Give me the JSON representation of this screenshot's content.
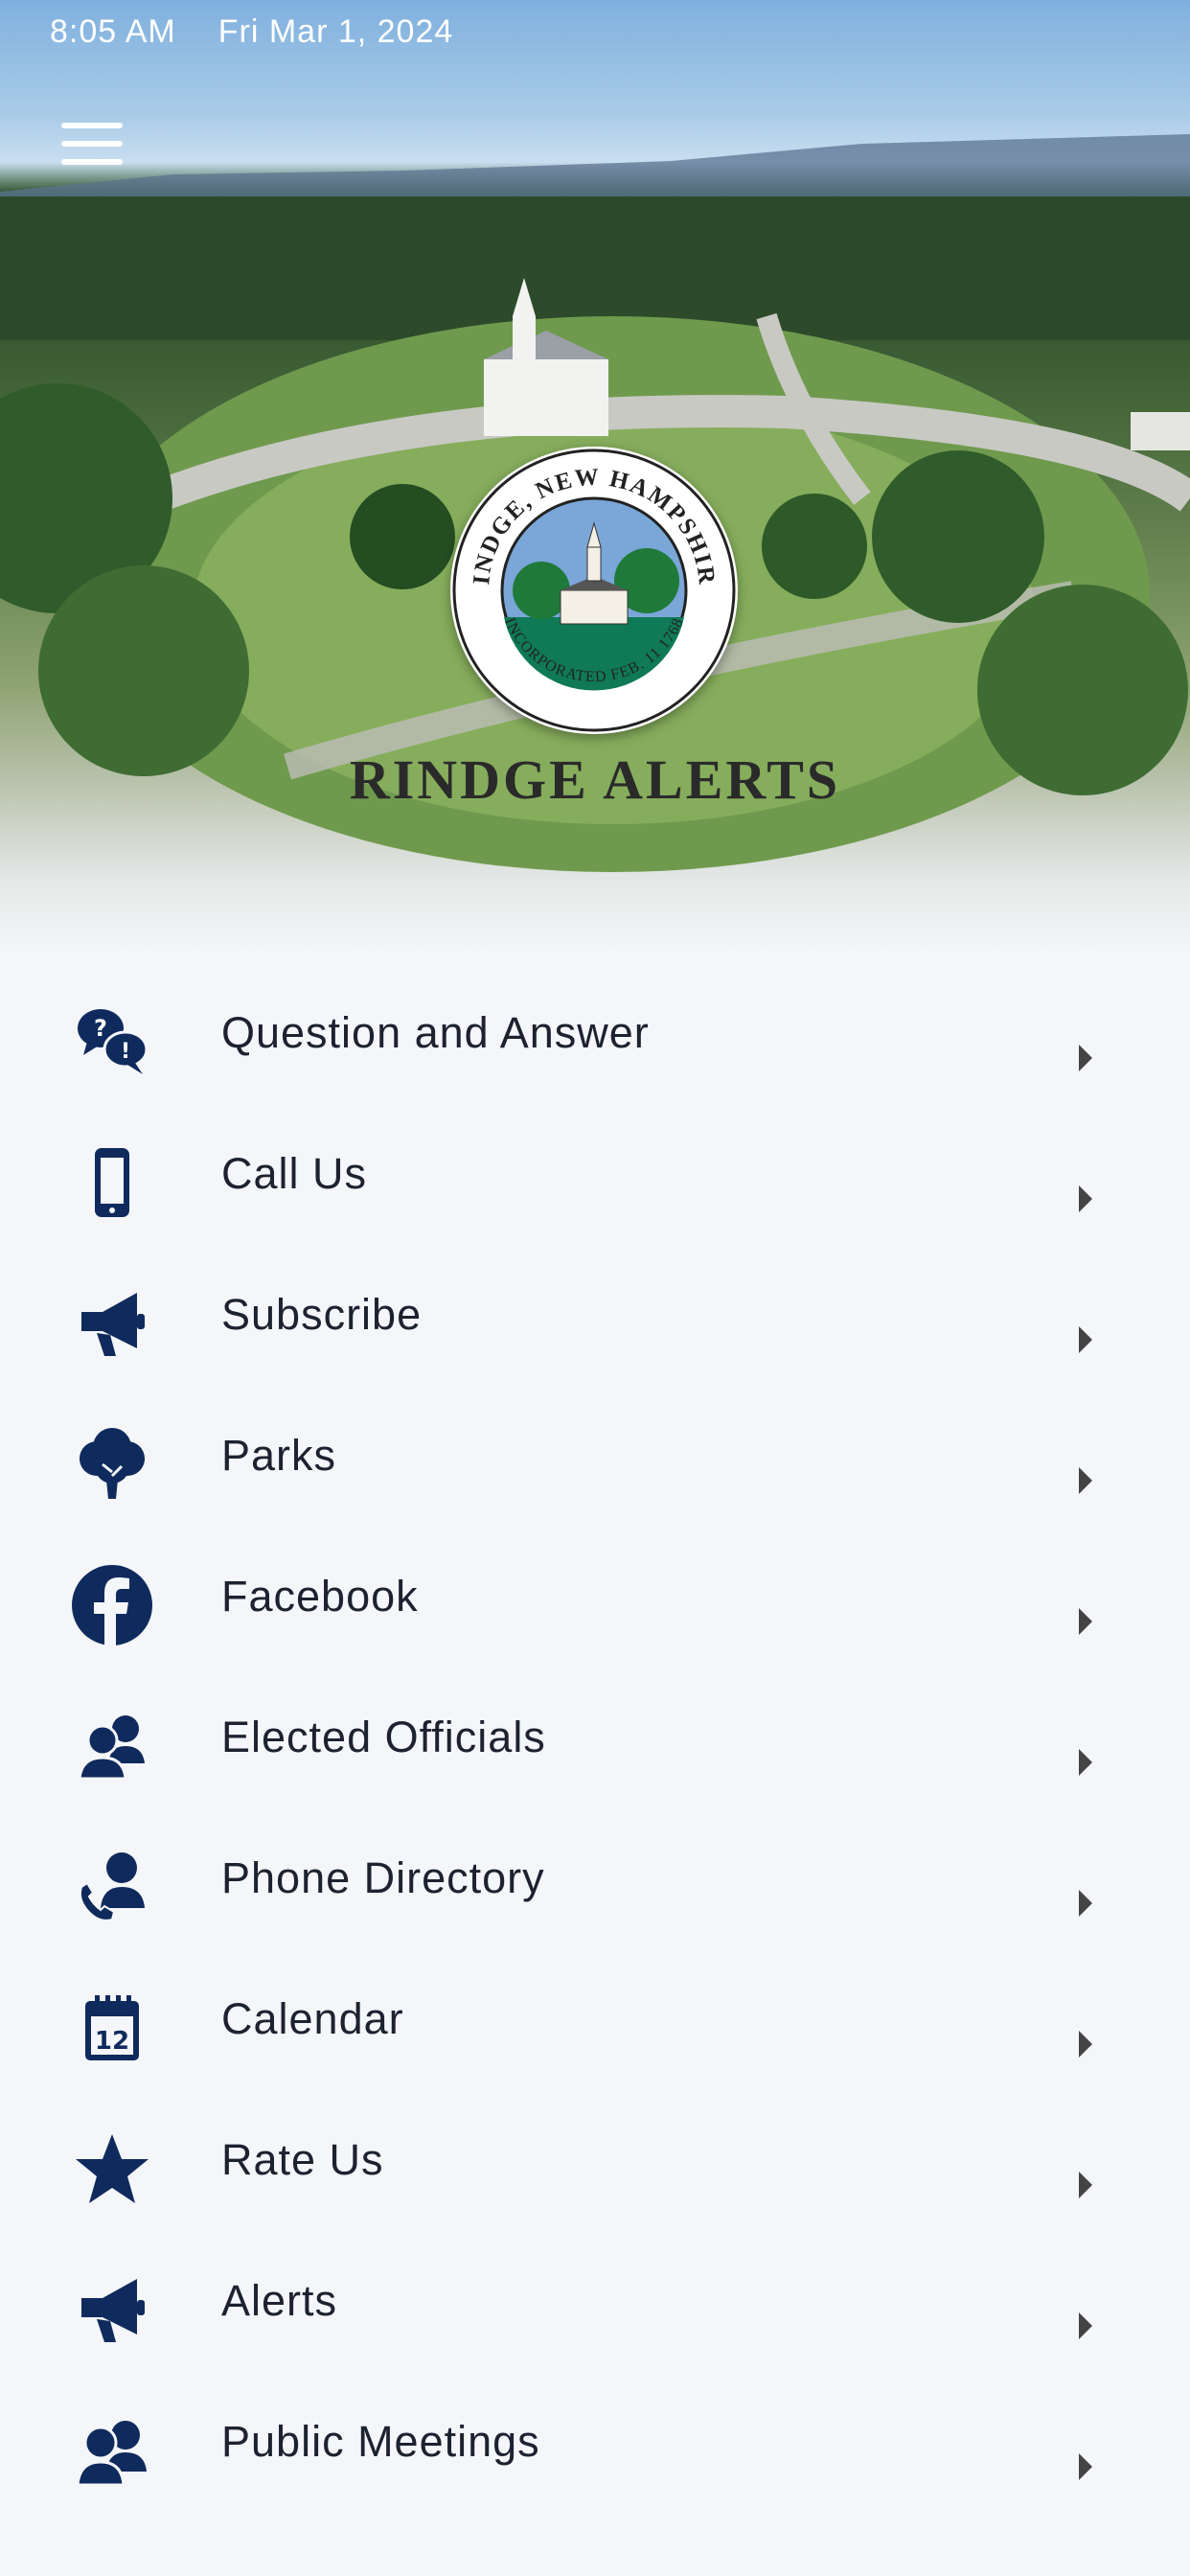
{
  "status_bar": {
    "time": "8:05 AM",
    "date": "Fri Mar 1, 2024"
  },
  "header": {
    "menu_icon": "hamburger-menu-icon",
    "seal": {
      "top_text": "RINDGE, NEW HAMPSHIRE",
      "bottom_text": "INCORPORATED FEB. 11 1768"
    },
    "title": "RINDGE ALERTS"
  },
  "menu": {
    "items": [
      {
        "label": "Question and Answer",
        "icon": "question-answer-icon"
      },
      {
        "label": "Call Us",
        "icon": "mobile-phone-icon"
      },
      {
        "label": "Subscribe",
        "icon": "megaphone-icon"
      },
      {
        "label": "Parks",
        "icon": "tree-icon"
      },
      {
        "label": "Facebook",
        "icon": "facebook-icon"
      },
      {
        "label": "Elected Officials",
        "icon": "people-icon"
      },
      {
        "label": "Phone Directory",
        "icon": "phone-contact-icon"
      },
      {
        "label": "Calendar",
        "icon": "calendar-icon"
      },
      {
        "label": "Rate Us",
        "icon": "star-icon"
      },
      {
        "label": "Alerts",
        "icon": "megaphone-icon"
      },
      {
        "label": "Public Meetings",
        "icon": "meeting-people-icon"
      }
    ]
  },
  "colors": {
    "icon": "#0f2a5c",
    "background": "#f5f6f9",
    "seal_green": "#0f7a55"
  }
}
